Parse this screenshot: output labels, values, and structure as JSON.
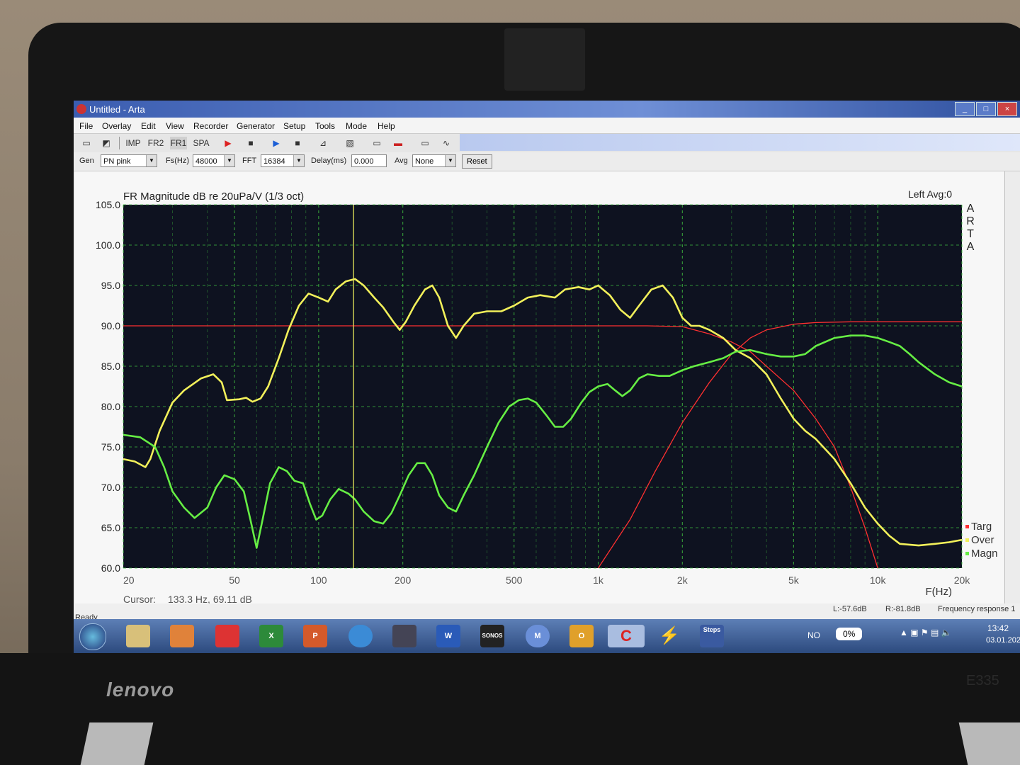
{
  "window": {
    "title": "Untitled - Arta",
    "min": "_",
    "max": "□",
    "close": "×"
  },
  "menu": [
    "File",
    "Overlay",
    "Edit",
    "View",
    "Recorder",
    "Generator",
    "Setup",
    "Tools",
    "Mode",
    "Help"
  ],
  "toolbar": {
    "imp": "IMP",
    "frz": "FR2",
    "fr1": "FR1",
    "spa": "SPA"
  },
  "params": {
    "gen_label": "Gen",
    "gen_value": "PN pink",
    "fs_label": "Fs(Hz)",
    "fs_value": "48000",
    "fft_label": "FFT",
    "fft_value": "16384",
    "delay_label": "Delay(ms)",
    "delay_value": "0.000",
    "avg_label": "Avg",
    "avg_value": "None",
    "reset": "Reset"
  },
  "status": {
    "ready": "Ready",
    "left_level": "L:-57.6dB",
    "right_level": "R:-81.8dB",
    "mode": "Frequency response 1"
  },
  "taskbar": {
    "lang": "NO",
    "percent": "0%",
    "time": "13:42",
    "date": "03.01.202",
    "apps": [
      "",
      "",
      "",
      "",
      "X",
      "P",
      "",
      "",
      "W",
      "SONOS",
      "M",
      "O",
      "",
      "",
      "Steps"
    ]
  },
  "laptop": {
    "brand": "lenovo",
    "model": "E335"
  },
  "colors": {
    "targ": "#ff3030",
    "over": "#f2f05a",
    "magn": "#66ee44",
    "grid": "#3fbf3f",
    "cursor": "#e5e55a",
    "plot_bg": "#0e1220"
  },
  "chart_data": {
    "type": "line",
    "title": "FR Magnitude dB re 20uPa/V (1/3 oct)",
    "channel_info": "Left  Avg:0",
    "brand_vertical": "ARTA",
    "xlabel": "F(Hz)",
    "x_scale": "log",
    "xlim": [
      20,
      20000
    ],
    "ylim": [
      60,
      105
    ],
    "grid": true,
    "legend_position": "bottom-right",
    "x_tick_labels": [
      {
        "value": 20,
        "label": "20"
      },
      {
        "value": 50,
        "label": "50"
      },
      {
        "value": 100,
        "label": "100"
      },
      {
        "value": 200,
        "label": "200"
      },
      {
        "value": 500,
        "label": "500"
      },
      {
        "value": 1000,
        "label": "1k"
      },
      {
        "value": 2000,
        "label": "2k"
      },
      {
        "value": 5000,
        "label": "5k"
      },
      {
        "value": 10000,
        "label": "10k"
      },
      {
        "value": 20000,
        "label": "20k"
      }
    ],
    "y_tick_labels": [
      "60.0",
      "65.0",
      "70.0",
      "75.0",
      "80.0",
      "85.0",
      "90.0",
      "95.0",
      "100.0",
      "105.0"
    ],
    "y_ticks": [
      60,
      65,
      70,
      75,
      80,
      85,
      90,
      95,
      100,
      105
    ],
    "cursor": {
      "label": "Cursor:",
      "text": "133.3 Hz, 69.11 dB",
      "freq": 133.3
    },
    "series": [
      {
        "name": "Targ",
        "color": "#ff3030",
        "points": [
          [
            20,
            90
          ],
          [
            1500,
            90
          ],
          [
            2000,
            89.9
          ],
          [
            2500,
            89
          ],
          [
            3000,
            88
          ],
          [
            3500,
            86.8
          ],
          [
            4000,
            85
          ],
          [
            5000,
            82
          ],
          [
            6000,
            78.5
          ],
          [
            7000,
            75
          ],
          [
            8000,
            70
          ],
          [
            9000,
            65
          ],
          [
            10000,
            60
          ]
        ]
      },
      {
        "name": "Targ",
        "color": "#ff3030",
        "points": [
          [
            1000,
            60
          ],
          [
            1300,
            66
          ],
          [
            1600,
            72
          ],
          [
            2000,
            78
          ],
          [
            2500,
            83
          ],
          [
            3000,
            86.5
          ],
          [
            3500,
            88.5
          ],
          [
            4000,
            89.5
          ],
          [
            5000,
            90.2
          ],
          [
            6000,
            90.4
          ],
          [
            8000,
            90.5
          ],
          [
            20000,
            90.5
          ]
        ]
      },
      {
        "name": "Over",
        "color": "#f2f05a",
        "points": [
          [
            20,
            73.5
          ],
          [
            22,
            73.2
          ],
          [
            24,
            72.5
          ],
          [
            25,
            73.5
          ],
          [
            27,
            77
          ],
          [
            30,
            80.5
          ],
          [
            33,
            82
          ],
          [
            38,
            83.5
          ],
          [
            42,
            84
          ],
          [
            45,
            83
          ],
          [
            47,
            80.8
          ],
          [
            52,
            80.9
          ],
          [
            55,
            81.1
          ],
          [
            58,
            80.6
          ],
          [
            62,
            81
          ],
          [
            66,
            82.5
          ],
          [
            72,
            86
          ],
          [
            78,
            89.5
          ],
          [
            85,
            92.5
          ],
          [
            92,
            94
          ],
          [
            100,
            93.5
          ],
          [
            108,
            93
          ],
          [
            115,
            94.5
          ],
          [
            125,
            95.5
          ],
          [
            135,
            95.8
          ],
          [
            145,
            95
          ],
          [
            158,
            93.5
          ],
          [
            170,
            92.3
          ],
          [
            185,
            90.5
          ],
          [
            195,
            89.5
          ],
          [
            205,
            90.5
          ],
          [
            220,
            92.5
          ],
          [
            240,
            94.5
          ],
          [
            255,
            95
          ],
          [
            270,
            93.5
          ],
          [
            290,
            90
          ],
          [
            310,
            88.5
          ],
          [
            330,
            90
          ],
          [
            360,
            91.5
          ],
          [
            400,
            91.8
          ],
          [
            450,
            91.8
          ],
          [
            500,
            92.5
          ],
          [
            560,
            93.5
          ],
          [
            620,
            93.8
          ],
          [
            700,
            93.5
          ],
          [
            760,
            94.5
          ],
          [
            850,
            94.8
          ],
          [
            930,
            94.5
          ],
          [
            1000,
            95
          ],
          [
            1100,
            93.8
          ],
          [
            1200,
            92
          ],
          [
            1300,
            91
          ],
          [
            1400,
            92.5
          ],
          [
            1550,
            94.5
          ],
          [
            1700,
            95
          ],
          [
            1850,
            93.5
          ],
          [
            2000,
            91
          ],
          [
            2150,
            90
          ],
          [
            2300,
            90
          ],
          [
            2500,
            89.5
          ],
          [
            2800,
            88.5
          ],
          [
            3100,
            87
          ],
          [
            3500,
            86
          ],
          [
            4000,
            84
          ],
          [
            4500,
            81
          ],
          [
            5000,
            78.5
          ],
          [
            5500,
            77
          ],
          [
            6000,
            76
          ],
          [
            7000,
            73.5
          ],
          [
            8000,
            70.5
          ],
          [
            9000,
            67.5
          ],
          [
            10000,
            65.5
          ],
          [
            11000,
            64
          ],
          [
            12000,
            63
          ],
          [
            14000,
            62.8
          ],
          [
            16000,
            63
          ],
          [
            18000,
            63.2
          ],
          [
            20000,
            63.5
          ]
        ]
      },
      {
        "name": "Magn",
        "color": "#66ee44",
        "points": [
          [
            20,
            76.5
          ],
          [
            23,
            76.2
          ],
          [
            26,
            75
          ],
          [
            28,
            72.5
          ],
          [
            30,
            69.5
          ],
          [
            33,
            67.5
          ],
          [
            36,
            66.2
          ],
          [
            40,
            67.5
          ],
          [
            43,
            70
          ],
          [
            46,
            71.5
          ],
          [
            50,
            71
          ],
          [
            54,
            69.5
          ],
          [
            57,
            66
          ],
          [
            60,
            62.5
          ],
          [
            63,
            66
          ],
          [
            67,
            70.5
          ],
          [
            72,
            72.5
          ],
          [
            77,
            72
          ],
          [
            82,
            70.8
          ],
          [
            88,
            70.5
          ],
          [
            93,
            68
          ],
          [
            98,
            66
          ],
          [
            103,
            66.5
          ],
          [
            110,
            68.5
          ],
          [
            118,
            69.8
          ],
          [
            128,
            69.2
          ],
          [
            135,
            68.5
          ],
          [
            145,
            67
          ],
          [
            158,
            65.8
          ],
          [
            170,
            65.5
          ],
          [
            182,
            66.8
          ],
          [
            195,
            69
          ],
          [
            210,
            71.5
          ],
          [
            225,
            73
          ],
          [
            240,
            73
          ],
          [
            255,
            71.5
          ],
          [
            270,
            69
          ],
          [
            290,
            67.5
          ],
          [
            310,
            67
          ],
          [
            330,
            69
          ],
          [
            360,
            71.5
          ],
          [
            400,
            75
          ],
          [
            440,
            78
          ],
          [
            480,
            80
          ],
          [
            520,
            80.8
          ],
          [
            560,
            81
          ],
          [
            600,
            80.5
          ],
          [
            650,
            79
          ],
          [
            700,
            77.5
          ],
          [
            750,
            77.5
          ],
          [
            800,
            78.5
          ],
          [
            870,
            80.5
          ],
          [
            930,
            81.8
          ],
          [
            1000,
            82.5
          ],
          [
            1080,
            82.8
          ],
          [
            1150,
            82
          ],
          [
            1220,
            81.3
          ],
          [
            1300,
            82
          ],
          [
            1400,
            83.5
          ],
          [
            1500,
            84
          ],
          [
            1650,
            83.8
          ],
          [
            1800,
            83.8
          ],
          [
            2000,
            84.5
          ],
          [
            2200,
            85
          ],
          [
            2500,
            85.5
          ],
          [
            2800,
            86
          ],
          [
            3100,
            86.8
          ],
          [
            3500,
            87
          ],
          [
            4000,
            86.5
          ],
          [
            4500,
            86.2
          ],
          [
            5000,
            86.2
          ],
          [
            5500,
            86.5
          ],
          [
            6000,
            87.5
          ],
          [
            7000,
            88.5
          ],
          [
            8000,
            88.8
          ],
          [
            9000,
            88.8
          ],
          [
            10000,
            88.5
          ],
          [
            11000,
            88
          ],
          [
            12000,
            87.5
          ],
          [
            13000,
            86.5
          ],
          [
            14000,
            85.5
          ],
          [
            16000,
            84
          ],
          [
            18000,
            83
          ],
          [
            20000,
            82.5
          ]
        ]
      }
    ],
    "legend": [
      {
        "name": "Targ",
        "color": "#ff3030"
      },
      {
        "name": "Over",
        "color": "#f2f05a"
      },
      {
        "name": "Magn",
        "color": "#66ee44"
      }
    ]
  }
}
